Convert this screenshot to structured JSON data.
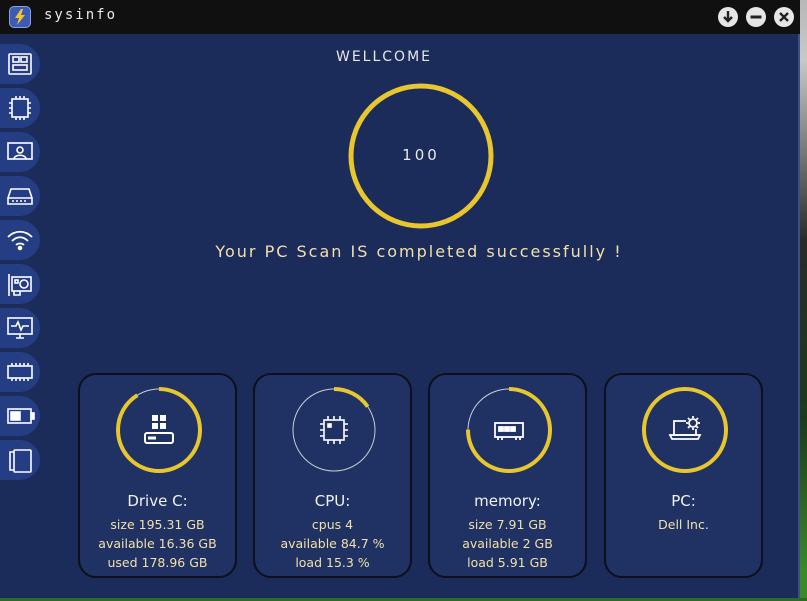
{
  "window": {
    "title": "sysinfo"
  },
  "title_buttons": [
    {
      "name": "download-icon"
    },
    {
      "name": "minimize-icon"
    },
    {
      "name": "close-icon"
    }
  ],
  "sidebar": [
    {
      "icon": "motherboard-icon"
    },
    {
      "icon": "cpu-chip-icon"
    },
    {
      "icon": "user-display-icon"
    },
    {
      "icon": "hard-drive-icon"
    },
    {
      "icon": "wifi-icon"
    },
    {
      "icon": "graphics-card-icon"
    },
    {
      "icon": "monitor-pulse-icon"
    },
    {
      "icon": "memory-module-icon"
    },
    {
      "icon": "battery-icon"
    },
    {
      "icon": "tablet-icon"
    }
  ],
  "main": {
    "welcome": "WELLCOME",
    "score": "100",
    "score_progress": 1.0,
    "message": "Your PC Scan IS completed successfully !"
  },
  "colors": {
    "accent": "#e8c62e",
    "panel": "#1b2b5a",
    "card": "#1f3263",
    "text": "#f2e0a8"
  },
  "cards": [
    {
      "icon": "windows-drive-icon",
      "title": "Drive C:",
      "progress": 0.91,
      "lines": [
        "size 195.31 GB",
        "available 16.36 GB",
        "used 178.96 GB"
      ]
    },
    {
      "icon": "cpu-chip-icon",
      "title": "CPU:",
      "progress": 0.153,
      "lines": [
        "cpus 4",
        "available 84.7 %",
        "load 15.3 %"
      ]
    },
    {
      "icon": "memory-module-icon",
      "title": "memory:",
      "progress": 0.75,
      "lines": [
        "size 7.91 GB",
        "available 2 GB",
        "load 5.91 GB"
      ]
    },
    {
      "icon": "laptop-settings-icon",
      "title": "PC:",
      "progress": 1.0,
      "lines": [
        "Dell Inc."
      ]
    }
  ]
}
